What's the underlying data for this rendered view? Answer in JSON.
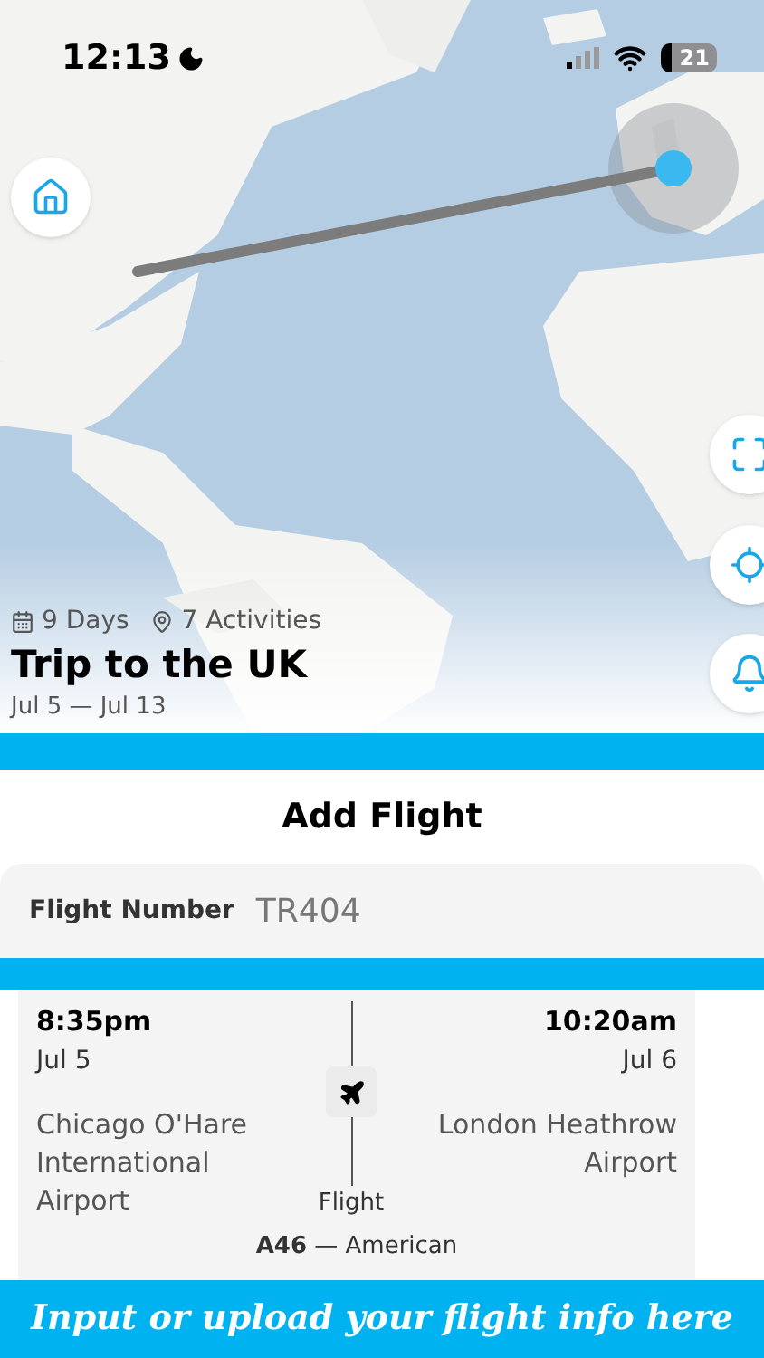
{
  "status_bar": {
    "time": "12:13",
    "battery": "21"
  },
  "trip": {
    "days": "9 Days",
    "activities": "7 Activities",
    "title": "Trip to the UK",
    "dates": "Jul 5 — Jul 13"
  },
  "sheet": {
    "title": "Add Flight",
    "field": {
      "label": "Flight Number",
      "value": "TR404"
    }
  },
  "flight": {
    "departure": {
      "time": "8:35pm",
      "date": "Jul 5",
      "airport": "Chicago O'Hare International Airport"
    },
    "arrival": {
      "time": "10:20am",
      "date": "Jul 6",
      "airport": "London Heathrow Airport"
    },
    "mode": "Flight",
    "carrier": "**A46** — American"
  },
  "banner": "Input or upload your flight info here"
}
